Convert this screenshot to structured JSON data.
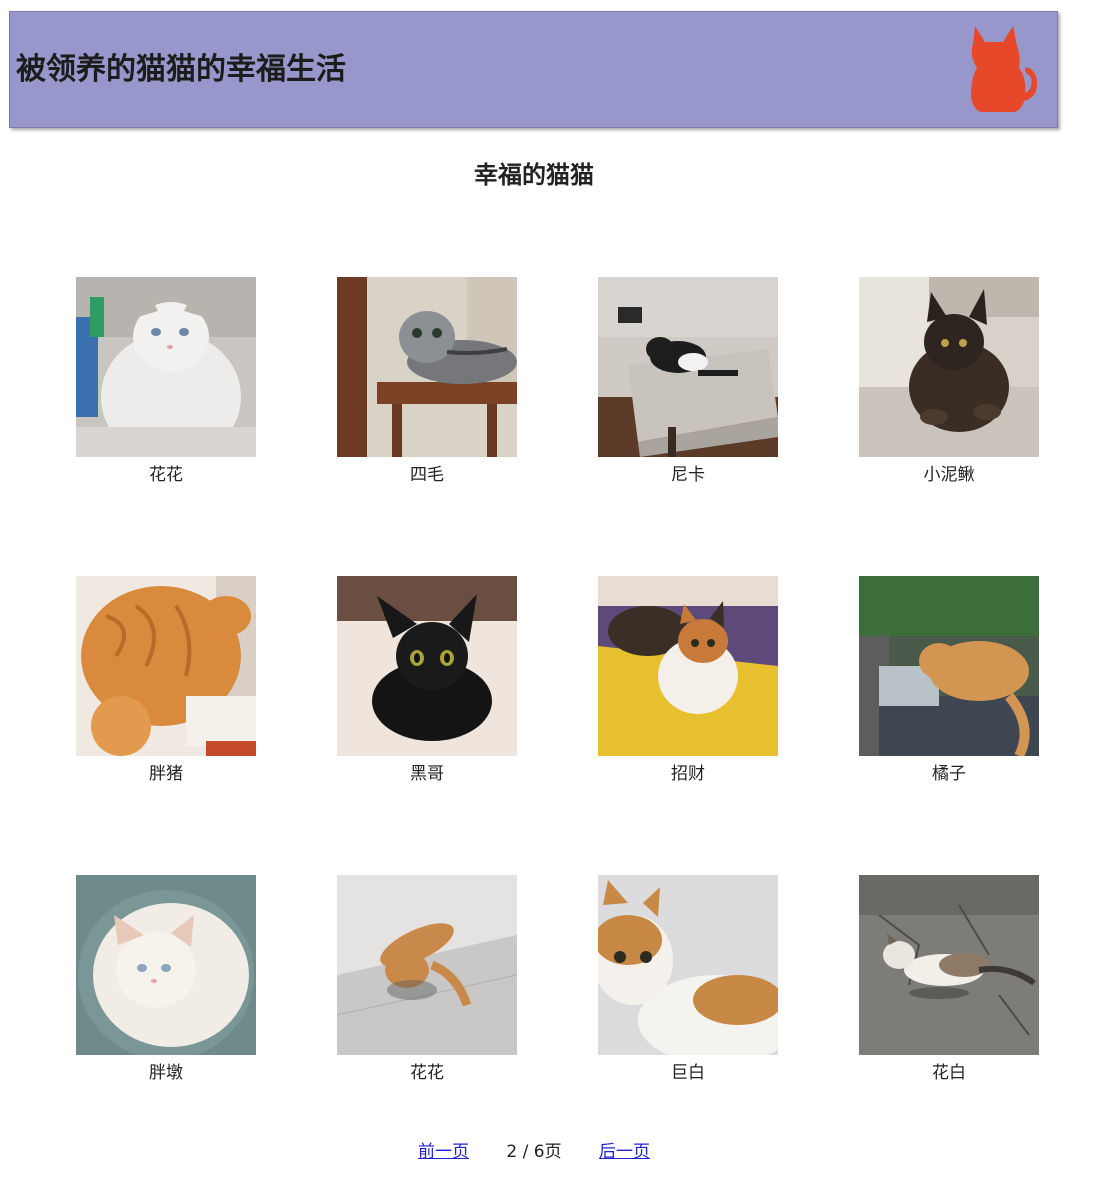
{
  "header": {
    "title": "被领养的猫猫的幸福生活",
    "logo_icon": "cat-silhouette-icon",
    "logo_color": "#e8482a",
    "background": "#9897cb"
  },
  "section_title": "幸福的猫猫",
  "cats": [
    {
      "name": "花花",
      "photo": "fluffy-white-ragdoll-cat-photo"
    },
    {
      "name": "四毛",
      "photo": "grey-tabby-fold-cat-on-chair-photo"
    },
    {
      "name": "尼卡",
      "photo": "tuxedo-cat-on-table-photo"
    },
    {
      "name": "小泥鳅",
      "photo": "tortoiseshell-cat-lying-photo"
    },
    {
      "name": "胖猪",
      "photo": "orange-cat-back-photo"
    },
    {
      "name": "黑哥",
      "photo": "black-kitten-photo"
    },
    {
      "name": "招财",
      "photo": "calico-cat-on-mat-photo"
    },
    {
      "name": "橘子",
      "photo": "orange-tabby-eating-photo"
    },
    {
      "name": "胖墩",
      "photo": "white-fluffy-cat-in-basket-photo"
    },
    {
      "name": "花花",
      "photo": "orange-cat-lying-on-floor-photo"
    },
    {
      "name": "巨白",
      "photo": "orange-white-cat-closeup-photo"
    },
    {
      "name": "花白",
      "photo": "tabby-white-cat-on-ground-photo"
    }
  ],
  "pager": {
    "prev_label": "前一页",
    "indicator": "2 / 6页",
    "next_label": "后一页"
  }
}
